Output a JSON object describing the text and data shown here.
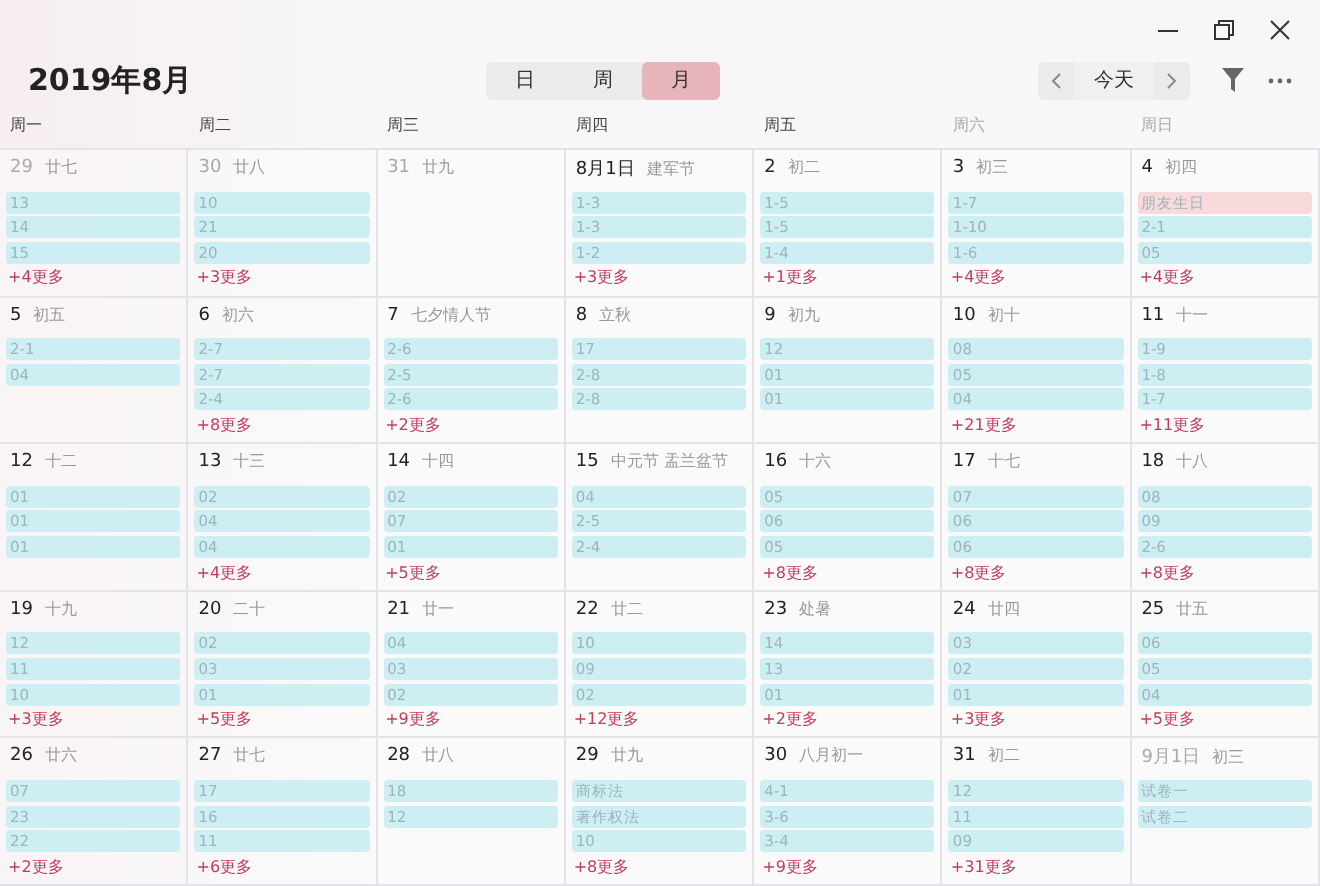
{
  "title": "2019年8月",
  "views": [
    {
      "label": "日",
      "selected": false
    },
    {
      "label": "周",
      "selected": false
    },
    {
      "label": "月",
      "selected": true
    }
  ],
  "today_button": "今天",
  "weekdays": [
    {
      "label": "周一",
      "weekend": false
    },
    {
      "label": "周二",
      "weekend": false
    },
    {
      "label": "周三",
      "weekend": false
    },
    {
      "label": "周四",
      "weekend": false
    },
    {
      "label": "周五",
      "weekend": false
    },
    {
      "label": "周六",
      "weekend": true
    },
    {
      "label": "周日",
      "weekend": true
    }
  ],
  "days": [
    {
      "day": "29",
      "lunar": "廿七",
      "in_month": false,
      "events": [
        {
          "title": "13",
          "color": "#cdeef3"
        },
        {
          "title": "14",
          "color": "#cdeef3"
        },
        {
          "title": "15",
          "color": "#cdeef3"
        }
      ],
      "more": "+4更多"
    },
    {
      "day": "30",
      "lunar": "廿八",
      "in_month": false,
      "events": [
        {
          "title": "10",
          "color": "#cdeef3"
        },
        {
          "title": "21",
          "color": "#cdeef3"
        },
        {
          "title": "20",
          "color": "#cdeef3"
        }
      ],
      "more": "+3更多"
    },
    {
      "day": "31",
      "lunar": "廿九",
      "in_month": false
    },
    {
      "day": "8月1日",
      "lunar": "建军节",
      "in_month": true,
      "events": [
        {
          "title": "1-3",
          "color": "#cdeef3"
        },
        {
          "title": "1-3",
          "color": "#cdeef3"
        },
        {
          "title": "1-2",
          "color": "#cdeef3"
        }
      ],
      "more": "+3更多"
    },
    {
      "day": "2",
      "lunar": "初二",
      "in_month": true,
      "events": [
        {
          "title": "1-5",
          "color": "#cdeef3"
        },
        {
          "title": "1-5",
          "color": "#cdeef3"
        },
        {
          "title": "1-4",
          "color": "#cdeef3"
        }
      ],
      "more": "+1更多"
    },
    {
      "day": "3",
      "lunar": "初三",
      "in_month": true,
      "events": [
        {
          "title": "1-7",
          "color": "#cdeef3"
        },
        {
          "title": "1-10",
          "color": "#cdeef3"
        },
        {
          "title": "1-6",
          "color": "#cdeef3"
        }
      ],
      "more": "+4更多"
    },
    {
      "day": "4",
      "lunar": "初四",
      "in_month": true,
      "events": [
        {
          "title": "朋友生日",
          "color": "#f8d9dc"
        },
        {
          "title": "2-1",
          "color": "#cdeef3"
        },
        {
          "title": "05",
          "color": "#cdeef3"
        }
      ],
      "more": "+4更多"
    },
    {
      "day": "5",
      "lunar": "初五",
      "in_month": true,
      "events": [
        {
          "title": "2-1",
          "color": "#cdeef3"
        },
        {
          "title": "04",
          "color": "#cdeef3"
        }
      ]
    },
    {
      "day": "6",
      "lunar": "初六",
      "in_month": true,
      "events": [
        {
          "title": "2-7",
          "color": "#cdeef3"
        },
        {
          "title": "2-7",
          "color": "#cdeef3"
        },
        {
          "title": "2-4",
          "color": "#cdeef3"
        }
      ],
      "more": "+8更多"
    },
    {
      "day": "7",
      "lunar": "七夕情人节",
      "in_month": true,
      "events": [
        {
          "title": "2-6",
          "color": "#cdeef3"
        },
        {
          "title": "2-5",
          "color": "#cdeef3"
        },
        {
          "title": "2-6",
          "color": "#cdeef3"
        }
      ],
      "more": "+2更多"
    },
    {
      "day": "8",
      "lunar": "立秋",
      "in_month": true,
      "events": [
        {
          "title": "17",
          "color": "#cdeef3"
        },
        {
          "title": "2-8",
          "color": "#cdeef3"
        },
        {
          "title": "2-8",
          "color": "#cdeef3"
        }
      ]
    },
    {
      "day": "9",
      "lunar": "初九",
      "in_month": true,
      "events": [
        {
          "title": "12",
          "color": "#cdeef3"
        },
        {
          "title": "01",
          "color": "#cdeef3"
        },
        {
          "title": "01",
          "color": "#cdeef3"
        }
      ]
    },
    {
      "day": "10",
      "lunar": "初十",
      "in_month": true,
      "events": [
        {
          "title": "08",
          "color": "#cdeef3"
        },
        {
          "title": "05",
          "color": "#cdeef3"
        },
        {
          "title": "04",
          "color": "#cdeef3"
        }
      ],
      "more": "+21更多"
    },
    {
      "day": "11",
      "lunar": "十一",
      "in_month": true,
      "events": [
        {
          "title": "1-9",
          "color": "#cdeef3"
        },
        {
          "title": "1-8",
          "color": "#cdeef3"
        },
        {
          "title": "1-7",
          "color": "#cdeef3"
        }
      ],
      "more": "+11更多"
    },
    {
      "day": "12",
      "lunar": "十二",
      "in_month": true,
      "events": [
        {
          "title": "01",
          "color": "#cdeef3"
        },
        {
          "title": "01",
          "color": "#cdeef3"
        },
        {
          "title": "01",
          "color": "#cdeef3"
        }
      ]
    },
    {
      "day": "13",
      "lunar": "十三",
      "in_month": true,
      "events": [
        {
          "title": "02",
          "color": "#cdeef3"
        },
        {
          "title": "04",
          "color": "#cdeef3"
        },
        {
          "title": "04",
          "color": "#cdeef3"
        }
      ],
      "more": "+4更多"
    },
    {
      "day": "14",
      "lunar": "十四",
      "in_month": true,
      "events": [
        {
          "title": "02",
          "color": "#cdeef3"
        },
        {
          "title": "07",
          "color": "#cdeef3"
        },
        {
          "title": "01",
          "color": "#cdeef3"
        }
      ],
      "more": "+5更多"
    },
    {
      "day": "15",
      "lunar": "中元节 盂兰盆节",
      "in_month": true,
      "events": [
        {
          "title": "04",
          "color": "#cdeef3"
        },
        {
          "title": "2-5",
          "color": "#cdeef3"
        },
        {
          "title": "2-4",
          "color": "#cdeef3"
        }
      ]
    },
    {
      "day": "16",
      "lunar": "十六",
      "in_month": true,
      "events": [
        {
          "title": "05",
          "color": "#cdeef3"
        },
        {
          "title": "06",
          "color": "#cdeef3"
        },
        {
          "title": "05",
          "color": "#cdeef3"
        }
      ],
      "more": "+8更多"
    },
    {
      "day": "17",
      "lunar": "十七",
      "in_month": true,
      "events": [
        {
          "title": "07",
          "color": "#cdeef3"
        },
        {
          "title": "06",
          "color": "#cdeef3"
        },
        {
          "title": "06",
          "color": "#cdeef3"
        }
      ],
      "more": "+8更多"
    },
    {
      "day": "18",
      "lunar": "十八",
      "in_month": true,
      "events": [
        {
          "title": "08",
          "color": "#cdeef3"
        },
        {
          "title": "09",
          "color": "#cdeef3"
        },
        {
          "title": "2-6",
          "color": "#cdeef3"
        }
      ],
      "more": "+8更多"
    },
    {
      "day": "19",
      "lunar": "十九",
      "in_month": true,
      "events": [
        {
          "title": "12",
          "color": "#cdeef3"
        },
        {
          "title": "11",
          "color": "#cdeef3"
        },
        {
          "title": "10",
          "color": "#cdeef3"
        }
      ],
      "more": "+3更多"
    },
    {
      "day": "20",
      "lunar": "二十",
      "in_month": true,
      "events": [
        {
          "title": "02",
          "color": "#cdeef3"
        },
        {
          "title": "03",
          "color": "#cdeef3"
        },
        {
          "title": "01",
          "color": "#cdeef3"
        }
      ],
      "more": "+5更多"
    },
    {
      "day": "21",
      "lunar": "廿一",
      "in_month": true,
      "events": [
        {
          "title": "04",
          "color": "#cdeef3"
        },
        {
          "title": "03",
          "color": "#cdeef3"
        },
        {
          "title": "02",
          "color": "#cdeef3"
        }
      ],
      "more": "+9更多"
    },
    {
      "day": "22",
      "lunar": "廿二",
      "in_month": true,
      "events": [
        {
          "title": "10",
          "color": "#cdeef3"
        },
        {
          "title": "09",
          "color": "#cdeef3"
        },
        {
          "title": "02",
          "color": "#cdeef3"
        }
      ],
      "more": "+12更多"
    },
    {
      "day": "23",
      "lunar": "处暑",
      "in_month": true,
      "events": [
        {
          "title": "14",
          "color": "#cdeef3"
        },
        {
          "title": "13",
          "color": "#cdeef3"
        },
        {
          "title": "01",
          "color": "#cdeef3"
        }
      ],
      "more": "+2更多"
    },
    {
      "day": "24",
      "lunar": "廿四",
      "in_month": true,
      "events": [
        {
          "title": "03",
          "color": "#cdeef3"
        },
        {
          "title": "02",
          "color": "#cdeef3"
        },
        {
          "title": "01",
          "color": "#cdeef3"
        }
      ],
      "more": "+3更多"
    },
    {
      "day": "25",
      "lunar": "廿五",
      "in_month": true,
      "events": [
        {
          "title": "06",
          "color": "#cdeef3"
        },
        {
          "title": "05",
          "color": "#cdeef3"
        },
        {
          "title": "04",
          "color": "#cdeef3"
        }
      ],
      "more": "+5更多"
    },
    {
      "day": "26",
      "lunar": "廿六",
      "in_month": true,
      "events": [
        {
          "title": "07",
          "color": "#cdeef3"
        },
        {
          "title": "23",
          "color": "#cdeef3"
        },
        {
          "title": "22",
          "color": "#cdeef3"
        }
      ],
      "more": "+2更多"
    },
    {
      "day": "27",
      "lunar": "廿七",
      "in_month": true,
      "events": [
        {
          "title": "17",
          "color": "#cdeef3"
        },
        {
          "title": "16",
          "color": "#cdeef3"
        },
        {
          "title": "11",
          "color": "#cdeef3"
        }
      ],
      "more": "+6更多"
    },
    {
      "day": "28",
      "lunar": "廿八",
      "in_month": true,
      "events": [
        {
          "title": "18",
          "color": "#cdeef3"
        },
        {
          "title": "12",
          "color": "#cdeef3"
        }
      ]
    },
    {
      "day": "29",
      "lunar": "廿九",
      "in_month": true,
      "events": [
        {
          "title": "商标法",
          "color": "#cdeef3"
        },
        {
          "title": "著作权法",
          "color": "#cdeef3"
        },
        {
          "title": "10",
          "color": "#cdeef3"
        }
      ],
      "more": "+8更多"
    },
    {
      "day": "30",
      "lunar": "八月初一",
      "in_month": true,
      "events": [
        {
          "title": "4-1",
          "color": "#cdeef3"
        },
        {
          "title": "3-6",
          "color": "#cdeef3"
        },
        {
          "title": "3-4",
          "color": "#cdeef3"
        }
      ],
      "more": "+9更多"
    },
    {
      "day": "31",
      "lunar": "初二",
      "in_month": true,
      "events": [
        {
          "title": "12",
          "color": "#cdeef3"
        },
        {
          "title": "11",
          "color": "#cdeef3"
        },
        {
          "title": "09",
          "color": "#cdeef3"
        }
      ],
      "more": "+31更多"
    },
    {
      "day": "9月1日",
      "lunar": "初三",
      "in_month": false,
      "events": [
        {
          "title": "试卷一",
          "color": "#cdeef3"
        },
        {
          "title": "试卷二",
          "color": "#cdeef3"
        }
      ]
    }
  ]
}
